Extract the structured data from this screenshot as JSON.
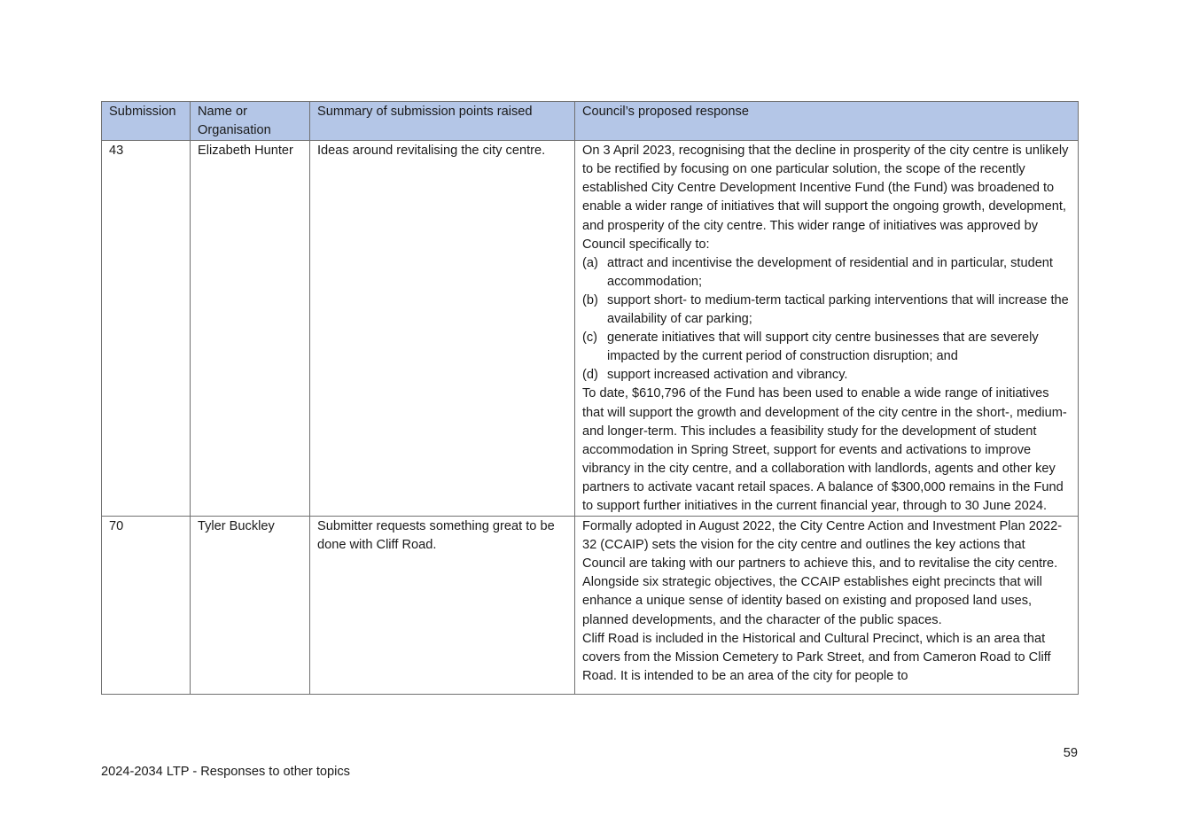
{
  "table": {
    "headers": [
      "Submission",
      "Name or Organisation",
      "Summary of submission points raised",
      "Council’s proposed response"
    ],
    "rows": [
      {
        "submission": "43",
        "name": "Elizabeth Hunter",
        "summary": "Ideas around revitalising the city centre.",
        "response": {
          "intro": "On 3 April 2023, recognising that the decline in prosperity of the city centre is unlikely to be rectified by focusing on one particular solution, the scope of the recently established City Centre Development Incentive Fund (the Fund) was broadened to enable a wider range of initiatives that will support the ongoing growth, development, and prosperity of the city centre. This wider range of initiatives was approved by Council specifically to:",
          "items": [
            {
              "label": "(a)",
              "text": "attract and incentivise the development of residential and in particular, student accommodation;"
            },
            {
              "label": "(b)",
              "text": "support short- to medium-term tactical parking interventions that will increase the availability of car parking;"
            },
            {
              "label": "(c)",
              "text": "generate initiatives that will support city centre businesses that are severely impacted by the current period of construction disruption; and"
            },
            {
              "label": "(d)",
              "text": "support increased activation and vibrancy."
            }
          ],
          "outro": "To date, $610,796 of the Fund has been used to enable a wide range of initiatives that will support the growth and development of the city centre in the short-, medium- and longer-term. This includes a feasibility study for the development of student accommodation in Spring Street, support for events and activations to improve vibrancy in the city centre, and a collaboration with landlords, agents and other key partners to activate vacant retail spaces. A balance of $300,000 remains in the Fund to support further initiatives in the current financial year, through to 30 June 2024."
        }
      },
      {
        "submission": "70",
        "name": "Tyler Buckley",
        "summary": "Submitter requests something great to be done with Cliff Road.",
        "response": {
          "p1": "Formally adopted in August 2022, the City Centre Action and Investment Plan 2022-32 (CCAIP) sets the vision for the city centre and outlines the key actions that Council are taking with our partners to achieve this, and to revitalise the city centre. Alongside six strategic objectives, the CCAIP establishes eight precincts that will enhance a unique sense of identity based on existing and proposed land uses, planned developments, and the character of the public spaces.",
          "p2": "Cliff Road is included in the Historical and Cultural Precinct, which is an area that covers from the Mission Cemetery to Park Street, and from Cameron Road to Cliff Road. It is intended to be an area of the city for people to"
        }
      }
    ]
  },
  "page_number": "59",
  "footer": "2024-2034 LTP - Responses to other topics"
}
